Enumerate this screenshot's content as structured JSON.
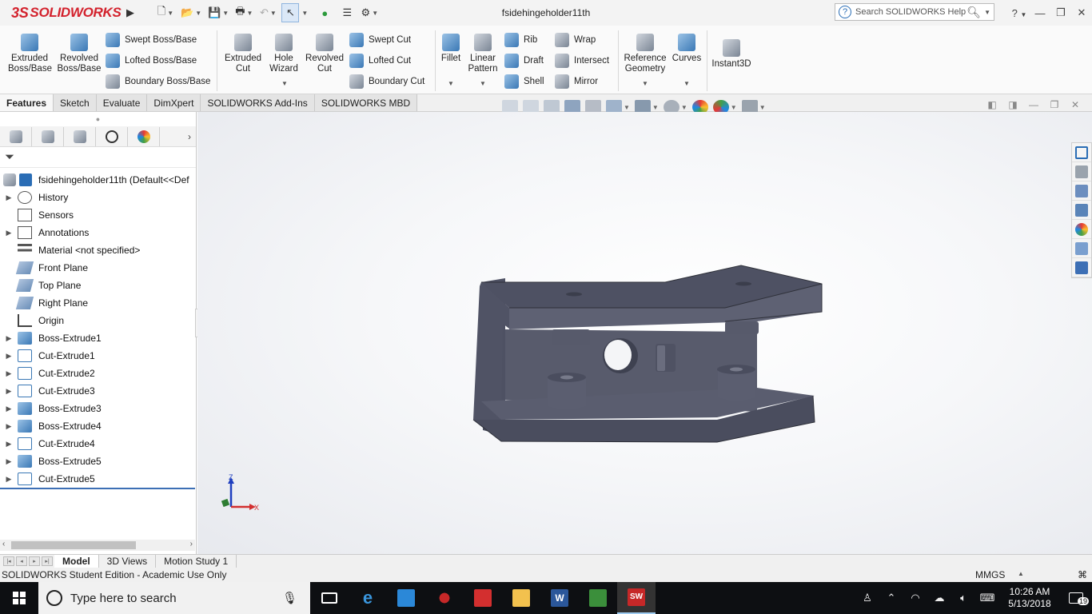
{
  "app": {
    "logo_ds": "3S",
    "logo_text": "SOLIDWORKS",
    "document_title": "fsidehingeholder11th",
    "search_placeholder": "Search SOLIDWORKS Help",
    "help_label": "?"
  },
  "ribbon": {
    "extruded_boss": "Extruded\nBoss/Base",
    "revolved_boss": "Revolved\nBoss/Base",
    "swept_boss": "Swept Boss/Base",
    "lofted_boss": "Lofted Boss/Base",
    "boundary_boss": "Boundary Boss/Base",
    "extruded_cut": "Extruded\nCut",
    "hole_wizard": "Hole\nWizard",
    "revolved_cut": "Revolved\nCut",
    "swept_cut": "Swept Cut",
    "lofted_cut": "Lofted Cut",
    "boundary_cut": "Boundary Cut",
    "fillet": "Fillet",
    "linear_pattern": "Linear\nPattern",
    "rib": "Rib",
    "draft": "Draft",
    "shell": "Shell",
    "wrap": "Wrap",
    "intersect": "Intersect",
    "mirror": "Mirror",
    "reference_geometry": "Reference\nGeometry",
    "curves": "Curves",
    "instant3d": "Instant3D"
  },
  "command_tabs": [
    "Features",
    "Sketch",
    "Evaluate",
    "DimXpert",
    "SOLIDWORKS Add-Ins",
    "SOLIDWORKS MBD"
  ],
  "tree": {
    "root": "fsidehingeholder11th  (Default<<Def",
    "items": [
      {
        "label": "History",
        "expandable": true
      },
      {
        "label": "Sensors",
        "expandable": false
      },
      {
        "label": "Annotations",
        "expandable": true
      },
      {
        "label": "Material <not specified>",
        "expandable": false
      },
      {
        "label": "Front Plane",
        "expandable": false
      },
      {
        "label": "Top Plane",
        "expandable": false
      },
      {
        "label": "Right Plane",
        "expandable": false
      },
      {
        "label": "Origin",
        "expandable": false
      },
      {
        "label": "Boss-Extrude1",
        "expandable": true
      },
      {
        "label": "Cut-Extrude1",
        "expandable": true
      },
      {
        "label": "Cut-Extrude2",
        "expandable": true
      },
      {
        "label": "Cut-Extrude3",
        "expandable": true
      },
      {
        "label": "Boss-Extrude3",
        "expandable": true
      },
      {
        "label": "Boss-Extrude4",
        "expandable": true
      },
      {
        "label": "Cut-Extrude4",
        "expandable": true
      },
      {
        "label": "Boss-Extrude5",
        "expandable": true
      },
      {
        "label": "Cut-Extrude5",
        "expandable": true
      }
    ]
  },
  "triad": {
    "z": "Z",
    "x": "X"
  },
  "bottom_tabs": [
    "Model",
    "3D Views",
    "Motion Study 1"
  ],
  "status": {
    "text": "SOLIDWORKS Student Edition - Academic Use Only",
    "units": "MMGS"
  },
  "taskbar": {
    "search_placeholder": "Type here to search",
    "time": "10:26 AM",
    "date": "5/13/2018",
    "notification_count": "19"
  },
  "colors": {
    "part_face": "#5c5f70",
    "part_top": "#4c4f60",
    "accent": "#3d6fb5",
    "logo_red": "#d3212c"
  }
}
